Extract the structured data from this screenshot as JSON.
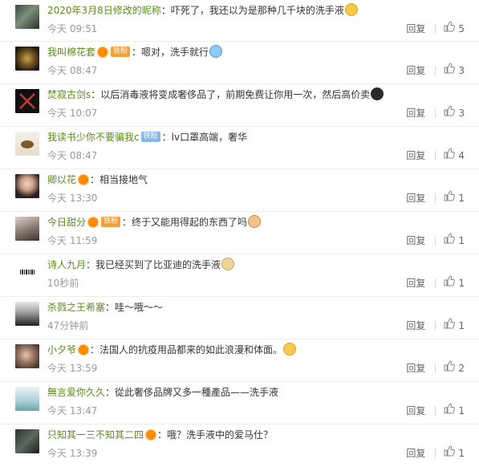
{
  "comments": [
    {
      "user": "2020年3月8日修改的昵称",
      "badge": "",
      "text": "吓死了，我还以为是那种几千块的洗手液",
      "emoji": "yellow-face-emoji",
      "time": "今天 09:51",
      "reply": "回复",
      "likes": "5"
    },
    {
      "user": "我叫棉花套",
      "badge": "铁粉",
      "text": "嗯对，洗手就行",
      "emoji": "blue-hands-emoji",
      "time": "今天 08:47",
      "reply": "回复",
      "likes": "3"
    },
    {
      "user": "焚寂古剑s",
      "badge": "",
      "text": "以后消毒液将变成奢侈品了，前期免费让你用一次，然后高价卖",
      "emoji": "dark-face-emoji",
      "time": "今天 10:07",
      "reply": "回复",
      "likes": "3"
    },
    {
      "user": "我读书少你不要骗我c",
      "badge": "铁粉",
      "text": "lv口罩高端，奢华",
      "emoji": "",
      "time": "今天 08:47",
      "reply": "回复",
      "likes": "4"
    },
    {
      "user": "卿以花",
      "badge": "",
      "text": "相当接地气",
      "emoji": "",
      "time": "今天 13:30",
      "reply": "回复",
      "likes": "1"
    },
    {
      "user": "今日甜分",
      "badge": "铁粉",
      "text": "终于又能用得起的东西了吗",
      "emoji": "cat-face-emoji",
      "time": "今天 11:59",
      "reply": "回复",
      "likes": "1"
    },
    {
      "user": "诗人九月",
      "badge": "",
      "text": "我已经买到了比亚迪的洗手液",
      "emoji": "dog-face-emoji",
      "time": "10秒前",
      "reply": "回复",
      "likes": "1"
    },
    {
      "user": "杀戮之王希塞",
      "badge": "",
      "text": "哇～哦～～",
      "emoji": "",
      "time": "47分钟前",
      "reply": "回复",
      "likes": "1"
    },
    {
      "user": "小夕爷",
      "badge": "",
      "text": "法国人的抗疫用品都来的如此浪漫和体面。",
      "emoji": "tongue-face-emoji",
      "time": "今天 13:59",
      "reply": "回复",
      "likes": "2"
    },
    {
      "user": "無言爱你久久",
      "badge": "",
      "text": "從此奢侈品牌又多一種產品——洗手液",
      "emoji": "",
      "time": "今天 13:47",
      "reply": "回复",
      "likes": "1"
    },
    {
      "user": "只知其一三不知其二四",
      "badge": "",
      "text": "哦？洗手液中的爱马仕？",
      "emoji": "",
      "time": "今天 13:39",
      "reply": "回复",
      "likes": "1"
    }
  ],
  "icons": {
    "like": "thumbs-up-icon",
    "vip": "vip-crown-icon"
  },
  "colors": {
    "username": "#5a8d18",
    "text": "#333333",
    "time": "#999999",
    "iron_fan_badge": "#f2a03c"
  }
}
